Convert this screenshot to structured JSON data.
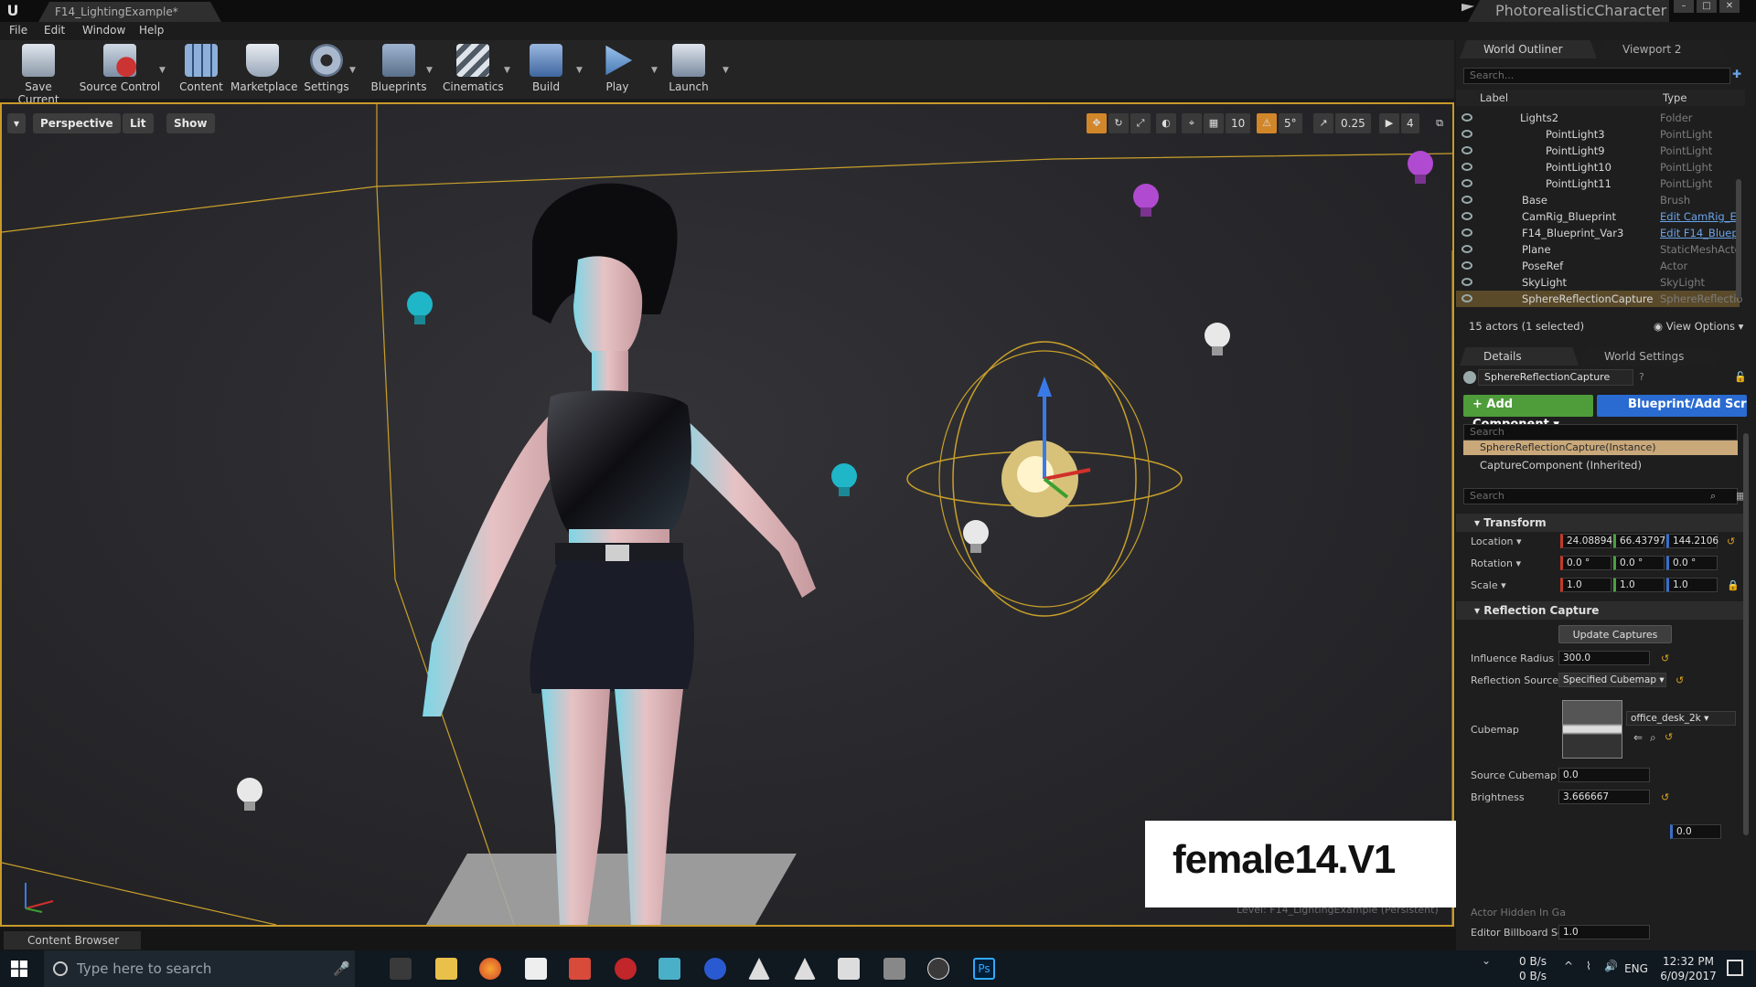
{
  "window": {
    "doc_tab": "F14_LightingExample*",
    "project_name": "PhotorealisticCharacter"
  },
  "menu": [
    "File",
    "Edit",
    "Window",
    "Help"
  ],
  "toolbar": {
    "save_current": "Save Current",
    "source_control": "Source Control",
    "content": "Content",
    "marketplace": "Marketplace",
    "settings": "Settings",
    "blueprints": "Blueprints",
    "cinematics": "Cinematics",
    "build": "Build",
    "play": "Play",
    "launch": "Launch"
  },
  "viewport": {
    "perspective": "Perspective",
    "lit": "Lit",
    "show": "Show",
    "grid_snap": "10",
    "rotation_snap": "5°",
    "scale_snap": "0.25",
    "camera_speed": "4",
    "level_label": "Level:  F14_LightingExample (Persistent)"
  },
  "watermark": {
    "text": "female14.V1",
    "logo_colors": [
      "#c0181e",
      "#e04040"
    ]
  },
  "outliner": {
    "tab": "World Outliner",
    "tab2": "Viewport 2",
    "search_placeholder": "Search...",
    "col_label": "Label",
    "col_type": "Type",
    "rows": [
      {
        "label": "Lights2",
        "type": "Folder"
      },
      {
        "label": "PointLight3",
        "type": "PointLight"
      },
      {
        "label": "PointLight9",
        "type": "PointLight"
      },
      {
        "label": "PointLight10",
        "type": "PointLight"
      },
      {
        "label": "PointLight11",
        "type": "PointLight"
      },
      {
        "label": "Base",
        "type": "Brush"
      },
      {
        "label": "CamRig_Blueprint",
        "type": "Edit CamRig_E"
      },
      {
        "label": "F14_Blueprint_Var3",
        "type": "Edit F14_Bluep"
      },
      {
        "label": "Plane",
        "type": "StaticMeshActo"
      },
      {
        "label": "PoseRef",
        "type": "Actor"
      },
      {
        "label": "SkyLight",
        "type": "SkyLight"
      },
      {
        "label": "SphereReflectionCapture",
        "type": "SphereReflectio"
      }
    ],
    "status": "15 actors (1 selected)",
    "view_options": "View Options"
  },
  "details": {
    "tab": "Details",
    "tab2": "World Settings",
    "object_name": "SphereReflectionCapture",
    "add_component": "+ Add Component",
    "blueprint_add": "Blueprint/Add Scr",
    "search_placeholder": "Search",
    "instance_label": "SphereReflectionCapture(Instance)",
    "capture_component": "CaptureComponent (Inherited)",
    "search2_placeholder": "Search",
    "transform_title": "Transform",
    "location_label": "Location",
    "location": [
      "24.08894",
      "66.43797",
      "144.2106"
    ],
    "rotation_label": "Rotation",
    "rotation": [
      "0.0 °",
      "0.0 °",
      "0.0 °"
    ],
    "scale_label": "Scale",
    "scale": [
      "1.0",
      "1.0",
      "1.0"
    ],
    "reflection_title": "Reflection Capture",
    "update_captures": "Update Captures",
    "influence_radius_label": "Influence Radius",
    "influence_radius": "300.0",
    "reflection_source_label": "Reflection Source",
    "reflection_source": "Specified Cubemap",
    "cubemap_label": "Cubemap",
    "cubemap_value": "office_desk_2k",
    "source_cubemap_label": "Source Cubemap A",
    "source_cubemap_value": "0.0",
    "brightness_label": "Brightness",
    "brightness": "3.666667",
    "z_value": "0.0",
    "actor_hidden_label": "Actor Hidden In Ga",
    "editor_billboard_label": "Editor Billboard Sc",
    "editor_billboard": "1.0"
  },
  "content_browser": {
    "tab": "Content Browser"
  },
  "taskbar": {
    "search_placeholder": "Type here to search",
    "net_up": "0 B/s",
    "net_down": "0 B/s",
    "lang": "ENG",
    "time": "12:32 PM",
    "date": "6/09/2017"
  }
}
